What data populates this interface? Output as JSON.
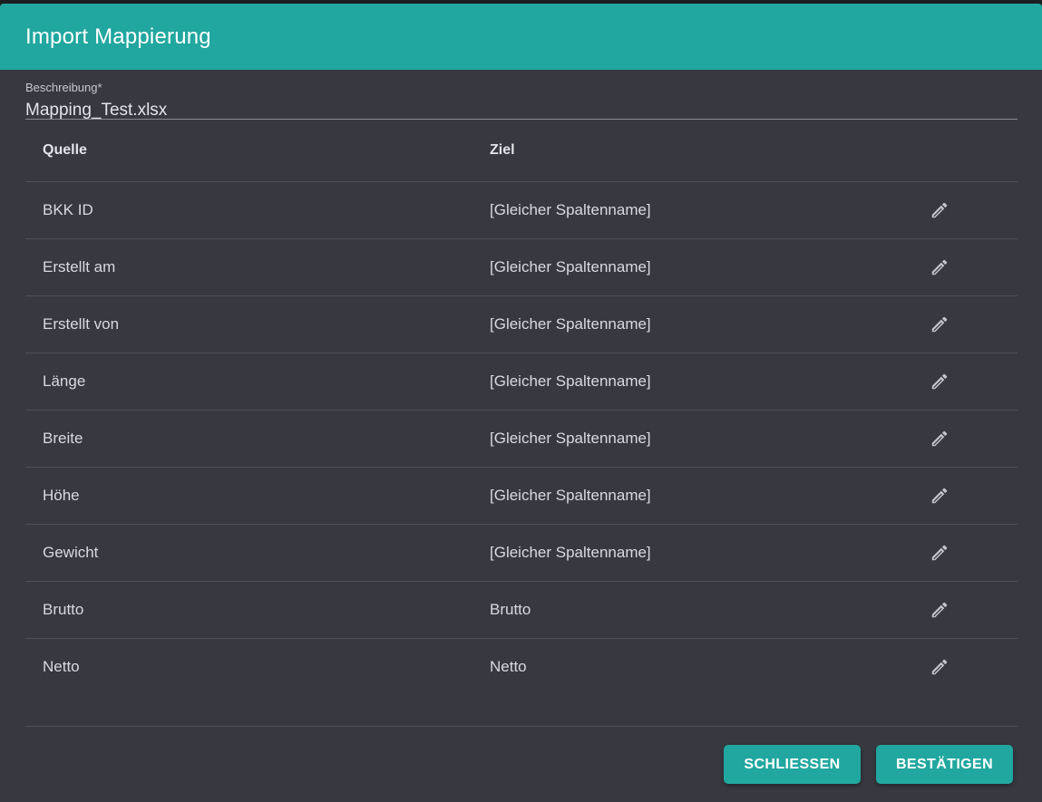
{
  "dialog": {
    "title": "Import Mappierung"
  },
  "description": {
    "label": "Beschreibung*",
    "value": "Mapping_Test.xlsx"
  },
  "table": {
    "headers": {
      "source": "Quelle",
      "target": "Ziel"
    },
    "rows": [
      {
        "source": "BKK ID",
        "target": "[Gleicher Spaltenname]"
      },
      {
        "source": "Erstellt am",
        "target": "[Gleicher Spaltenname]"
      },
      {
        "source": "Erstellt von",
        "target": "[Gleicher Spaltenname]"
      },
      {
        "source": "Länge",
        "target": "[Gleicher Spaltenname]"
      },
      {
        "source": "Breite",
        "target": "[Gleicher Spaltenname]"
      },
      {
        "source": "Höhe",
        "target": "[Gleicher Spaltenname]"
      },
      {
        "source": "Gewicht",
        "target": "[Gleicher Spaltenname]"
      },
      {
        "source": "Brutto",
        "target": "Brutto"
      },
      {
        "source": "Netto",
        "target": "Netto"
      }
    ],
    "row_action_icon": "pencil-icon"
  },
  "footer": {
    "close_label": "SCHLIESSEN",
    "confirm_label": "BESTÄTIGEN"
  },
  "colors": {
    "accent": "#21a79f",
    "background": "#373840"
  }
}
